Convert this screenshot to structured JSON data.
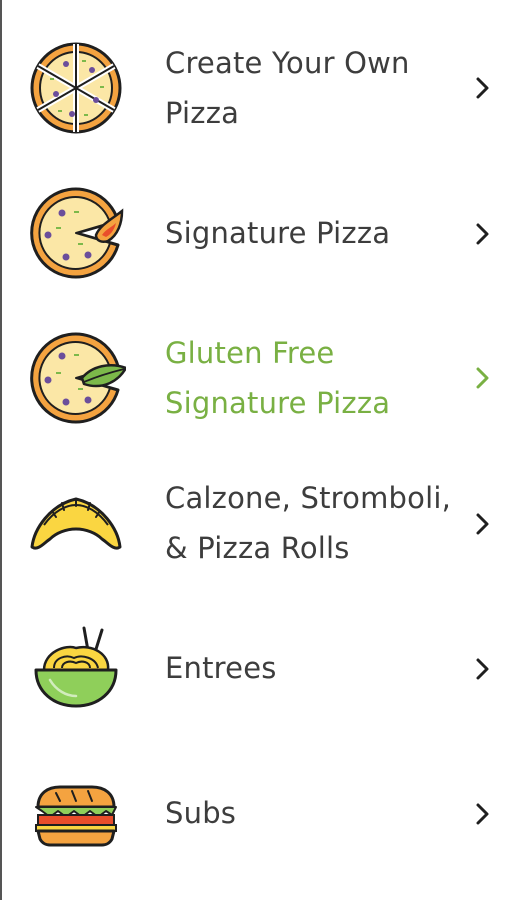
{
  "menu": {
    "items": [
      {
        "label": "Create Your Own\nPizza",
        "icon": "pizza-whole-icon",
        "active": false
      },
      {
        "label": "Signature Pizza",
        "icon": "pizza-flame-icon",
        "active": false
      },
      {
        "label": "Gluten Free\nSignature Pizza",
        "icon": "pizza-leaf-icon",
        "active": true
      },
      {
        "label": "Calzone, Stromboli,\n& Pizza Rolls",
        "icon": "calzone-icon",
        "active": false
      },
      {
        "label": "Entrees",
        "icon": "noodle-bowl-icon",
        "active": false
      },
      {
        "label": "Subs",
        "icon": "sub-sandwich-icon",
        "active": false
      }
    ]
  },
  "colors": {
    "text": "#3d3d3d",
    "active": "#79b043",
    "chevron": "#1f1f1f",
    "pizza_crust": "#f4a340",
    "pizza_cheese": "#fbe7a6",
    "topping": "#6b4e9b",
    "leaf": "#7cb94a",
    "calzone": "#fad641",
    "bowl": "#8fcf5a",
    "outline": "#1f1f1f"
  }
}
